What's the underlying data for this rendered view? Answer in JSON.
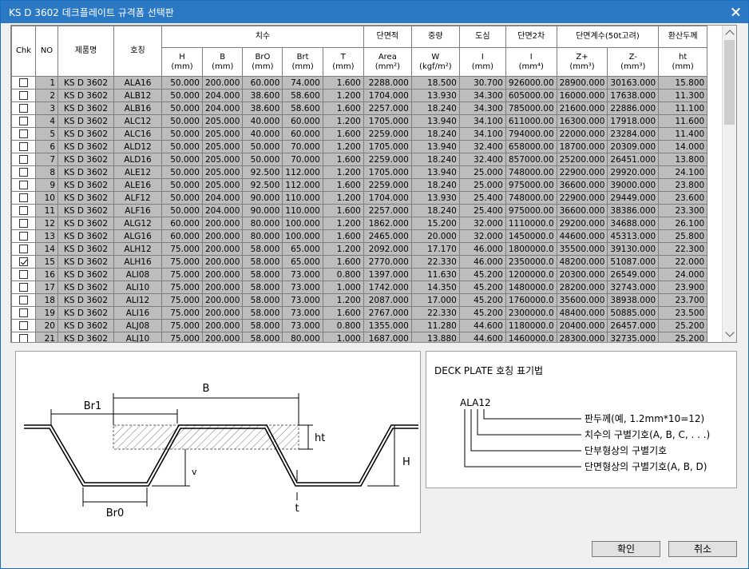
{
  "window": {
    "title": "KS D 3602 데크플레이트 규격폼 선택판"
  },
  "table": {
    "group_headers": {
      "dims": "치수",
      "area": "단면적",
      "weight": "중량",
      "centroid": "도심",
      "moment2": "단면2차",
      "modulus": "단면계수(50t고려)",
      "thick": "환산두께"
    },
    "columns": [
      {
        "label": "Chk"
      },
      {
        "label": "NO"
      },
      {
        "label": "제품명"
      },
      {
        "label": "호칭"
      },
      {
        "label": "H",
        "unit": "(mm)"
      },
      {
        "label": "B",
        "unit": "(mm)"
      },
      {
        "label": "BrO",
        "unit": "(mm)"
      },
      {
        "label": "Brt",
        "unit": "(mm)"
      },
      {
        "label": "T",
        "unit": "(mm)"
      },
      {
        "label": "Area",
        "unit": "(mm²)"
      },
      {
        "label": "W",
        "unit": "(kgf/m²)"
      },
      {
        "label": "I",
        "unit": "(mm)"
      },
      {
        "label": "I",
        "unit": "(mm⁴)"
      },
      {
        "label": "Z+",
        "unit": "(mm³)"
      },
      {
        "label": "Z-",
        "unit": "(mm³)"
      },
      {
        "label": "ht",
        "unit": "(mm)"
      }
    ],
    "rows": [
      {
        "checked": false,
        "cells": [
          "1",
          "KS D 3602",
          "ALA16",
          "50.000",
          "200.000",
          "60.000",
          "74.000",
          "1.600",
          "2288.000",
          "18.500",
          "30.700",
          "926000.00",
          "28900.000",
          "30163.000",
          "15.800"
        ]
      },
      {
        "checked": false,
        "cells": [
          "2",
          "KS D 3602",
          "ALB12",
          "50.000",
          "204.000",
          "38.600",
          "58.600",
          "1.200",
          "1704.000",
          "13.930",
          "34.300",
          "605000.00",
          "16000.000",
          "17638.000",
          "11.300"
        ]
      },
      {
        "checked": false,
        "cells": [
          "3",
          "KS D 3602",
          "ALB16",
          "50.000",
          "204.000",
          "38.600",
          "58.600",
          "1.600",
          "2257.000",
          "18.240",
          "34.300",
          "785000.00",
          "21600.000",
          "22886.000",
          "11.100"
        ]
      },
      {
        "checked": false,
        "cells": [
          "4",
          "KS D 3602",
          "ALC12",
          "50.000",
          "205.000",
          "40.000",
          "60.000",
          "1.200",
          "1705.000",
          "13.940",
          "34.100",
          "611000.00",
          "16300.000",
          "17918.000",
          "11.600"
        ]
      },
      {
        "checked": false,
        "cells": [
          "5",
          "KS D 3602",
          "ALC16",
          "50.000",
          "205.000",
          "40.000",
          "60.000",
          "1.600",
          "2259.000",
          "18.240",
          "34.100",
          "794000.00",
          "22000.000",
          "23284.000",
          "11.400"
        ]
      },
      {
        "checked": false,
        "cells": [
          "6",
          "KS D 3602",
          "ALD12",
          "50.000",
          "205.000",
          "50.000",
          "70.000",
          "1.200",
          "1705.000",
          "13.940",
          "32.400",
          "658000.00",
          "18700.000",
          "20309.000",
          "14.000"
        ]
      },
      {
        "checked": false,
        "cells": [
          "7",
          "KS D 3602",
          "ALD16",
          "50.000",
          "205.000",
          "50.000",
          "70.000",
          "1.600",
          "2259.000",
          "18.240",
          "32.400",
          "857000.00",
          "25200.000",
          "26451.000",
          "13.800"
        ]
      },
      {
        "checked": false,
        "cells": [
          "8",
          "KS D 3602",
          "ALE12",
          "50.000",
          "205.000",
          "92.500",
          "112.000",
          "1.200",
          "1705.000",
          "13.940",
          "25.000",
          "748000.00",
          "22900.000",
          "29920.000",
          "24.100"
        ]
      },
      {
        "checked": false,
        "cells": [
          "9",
          "KS D 3602",
          "ALE16",
          "50.000",
          "205.000",
          "92.500",
          "112.000",
          "1.600",
          "2259.000",
          "18.240",
          "25.000",
          "975000.00",
          "36600.000",
          "39000.000",
          "23.800"
        ]
      },
      {
        "checked": false,
        "cells": [
          "10",
          "KS D 3602",
          "ALF12",
          "50.000",
          "204.000",
          "90.000",
          "110.000",
          "1.200",
          "1704.000",
          "13.930",
          "25.400",
          "748000.00",
          "22900.000",
          "29449.000",
          "23.600"
        ]
      },
      {
        "checked": false,
        "cells": [
          "11",
          "KS D 3602",
          "ALF16",
          "50.000",
          "204.000",
          "90.000",
          "110.000",
          "1.600",
          "2257.000",
          "18.240",
          "25.400",
          "975000.00",
          "36600.000",
          "38386.000",
          "23.300"
        ]
      },
      {
        "checked": false,
        "cells": [
          "12",
          "KS D 3602",
          "ALG12",
          "60.000",
          "200.000",
          "80.000",
          "100.000",
          "1.200",
          "1862.000",
          "15.200",
          "32.000",
          "1110000.0",
          "29200.000",
          "34688.000",
          "26.100"
        ]
      },
      {
        "checked": false,
        "cells": [
          "13",
          "KS D 3602",
          "ALG16",
          "60.000",
          "200.000",
          "80.000",
          "100.000",
          "1.600",
          "2465.000",
          "20.000",
          "32.000",
          "1450000.0",
          "44600.000",
          "45313.000",
          "25.800"
        ]
      },
      {
        "checked": false,
        "cells": [
          "14",
          "KS D 3602",
          "ALH12",
          "75.000",
          "200.000",
          "58.000",
          "65.000",
          "1.200",
          "2092.000",
          "17.170",
          "46.000",
          "1800000.0",
          "35500.000",
          "39130.000",
          "22.300"
        ]
      },
      {
        "checked": true,
        "cells": [
          "15",
          "KS D 3602",
          "ALH16",
          "75.000",
          "200.000",
          "58.000",
          "65.000",
          "1.600",
          "2770.000",
          "22.330",
          "46.000",
          "2350000.0",
          "48200.000",
          "51087.000",
          "22.000"
        ]
      },
      {
        "checked": false,
        "cells": [
          "16",
          "KS D 3602",
          "ALI08",
          "75.000",
          "200.000",
          "58.000",
          "73.000",
          "0.800",
          "1397.000",
          "11.630",
          "45.200",
          "1200000.0",
          "20300.000",
          "26549.000",
          "24.000"
        ]
      },
      {
        "checked": false,
        "cells": [
          "17",
          "KS D 3602",
          "ALI10",
          "75.000",
          "200.000",
          "58.000",
          "73.000",
          "1.000",
          "1742.000",
          "14.350",
          "45.200",
          "1480000.0",
          "28200.000",
          "32743.000",
          "23.900"
        ]
      },
      {
        "checked": false,
        "cells": [
          "18",
          "KS D 3602",
          "ALI12",
          "75.000",
          "200.000",
          "58.000",
          "73.000",
          "1.200",
          "2087.000",
          "17.000",
          "45.200",
          "1760000.0",
          "35600.000",
          "38938.000",
          "23.700"
        ]
      },
      {
        "checked": false,
        "cells": [
          "19",
          "KS D 3602",
          "ALI16",
          "75.000",
          "200.000",
          "58.000",
          "73.000",
          "1.600",
          "2767.000",
          "22.330",
          "45.200",
          "2300000.0",
          "48400.000",
          "50885.000",
          "23.500"
        ]
      },
      {
        "checked": false,
        "cells": [
          "20",
          "KS D 3602",
          "ALJ08",
          "75.000",
          "200.000",
          "58.000",
          "73.000",
          "0.800",
          "1355.000",
          "11.280",
          "44.600",
          "1180000.0",
          "20400.000",
          "26457.000",
          "25.200"
        ]
      },
      {
        "checked": false,
        "cells": [
          "21",
          "KS D 3602",
          "ALJ10",
          "75.000",
          "200.000",
          "58.000",
          "80.000",
          "1.000",
          "1687.000",
          "13.880",
          "44.600",
          "1460000.0",
          "28300.000",
          "32735.000",
          "25.200"
        ]
      }
    ]
  },
  "diagram": {
    "labels": [
      "B",
      "Br1",
      "ht",
      "H",
      "v",
      "Br0",
      "t"
    ]
  },
  "legend": {
    "title": "DECK PLATE 호칭 표기법",
    "example": "ALA12",
    "items": [
      "판두께(예, 1.2mm*10=12)",
      "치수의 구별기호(A, B, C, . . .)",
      "단부형상의 구별기호",
      "단면형상의 구별기호(A, B, D)"
    ]
  },
  "buttons": {
    "ok": "확인",
    "cancel": "취소"
  },
  "icons": {
    "close": "close-icon",
    "scroll_up": "chevron-up-icon",
    "scroll_down": "chevron-down-icon",
    "check": "check-icon"
  }
}
